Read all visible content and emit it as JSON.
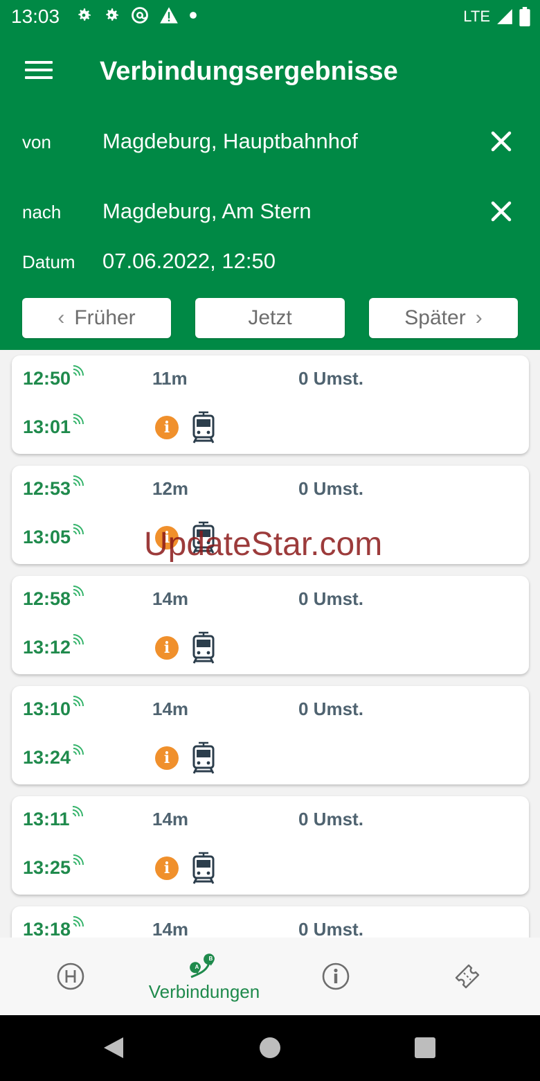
{
  "status_bar": {
    "time": "13:03",
    "network": "LTE",
    "icons": [
      "gear-icon",
      "gear-icon",
      "at-icon",
      "warning-icon",
      "dot-icon",
      "signal-icon",
      "battery-icon"
    ]
  },
  "header": {
    "title": "Verbindungsergebnisse",
    "from_label": "von",
    "from_value": "Magdeburg, Hauptbahnhof",
    "to_label": "nach",
    "to_value": "Magdeburg, Am Stern",
    "date_label": "Datum",
    "date_value": "07.06.2022, 12:50"
  },
  "nav_buttons": {
    "earlier": "Früher",
    "now": "Jetzt",
    "later": "Später"
  },
  "connections": [
    {
      "dep": "12:50",
      "arr": "13:01",
      "duration": "11m",
      "changes": "0 Umst.",
      "info": "i"
    },
    {
      "dep": "12:53",
      "arr": "13:05",
      "duration": "12m",
      "changes": "0 Umst.",
      "info": "i"
    },
    {
      "dep": "12:58",
      "arr": "13:12",
      "duration": "14m",
      "changes": "0 Umst.",
      "info": "i"
    },
    {
      "dep": "13:10",
      "arr": "13:24",
      "duration": "14m",
      "changes": "0 Umst.",
      "info": "i"
    },
    {
      "dep": "13:11",
      "arr": "13:25",
      "duration": "14m",
      "changes": "0 Umst.",
      "info": "i"
    },
    {
      "dep": "13:18",
      "duration": "14m",
      "changes": "0 Umst."
    }
  ],
  "watermark": "UpdateStar.com",
  "bottom_nav": {
    "active_label": "Verbindungen",
    "items": [
      "stop-h-icon",
      "route-ab-icon",
      "info-icon",
      "ticket-icon"
    ]
  },
  "colors": {
    "brand_green": "#008945",
    "time_green": "#1f8a4c",
    "info_orange": "#f0902c"
  }
}
